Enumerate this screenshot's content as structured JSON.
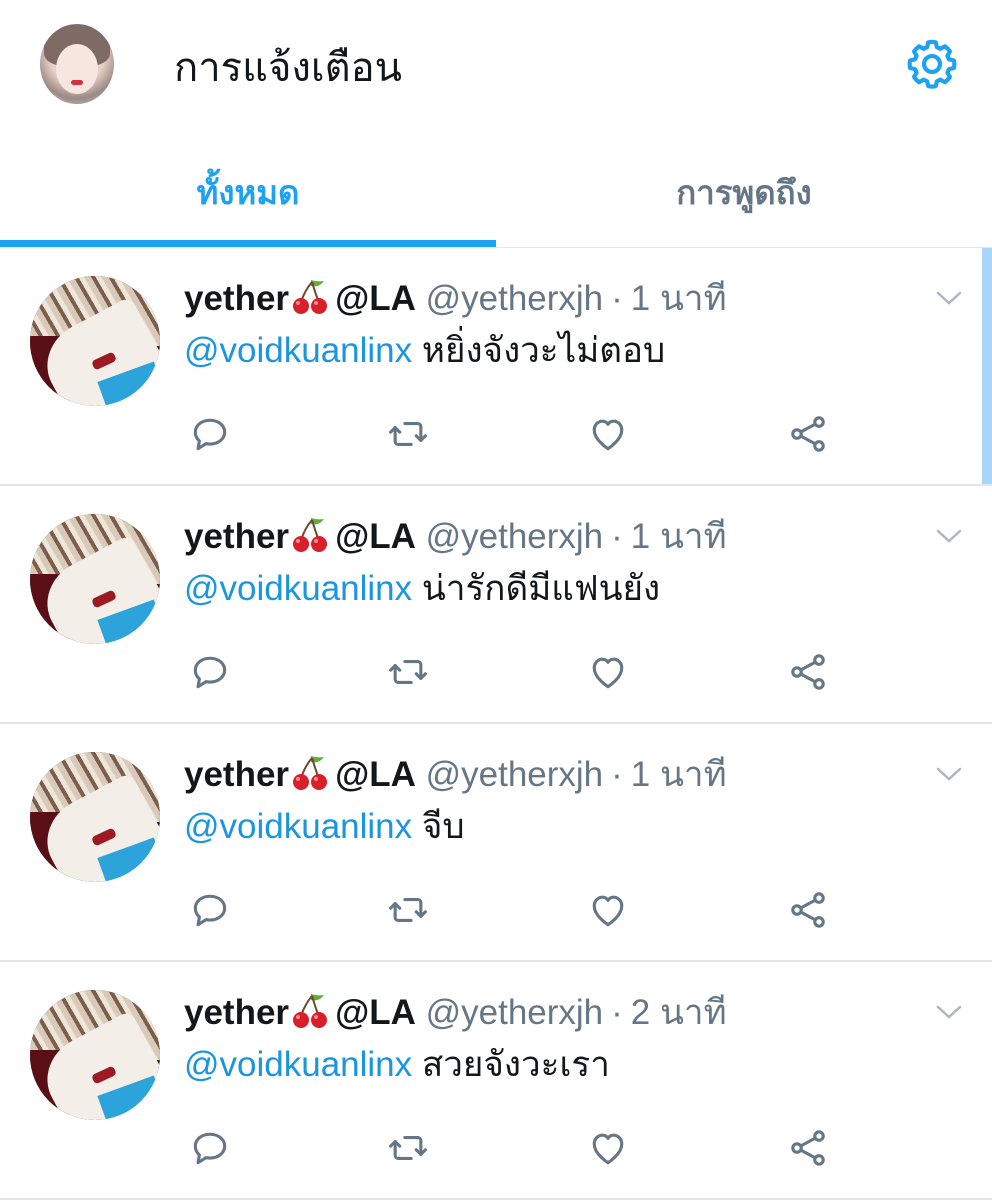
{
  "header": {
    "title": "การแจ้งเตือน",
    "settings_icon": "gear-icon"
  },
  "tabs": [
    {
      "label": "ทั้งหมด",
      "active": true
    },
    {
      "label": "การพูดถึง",
      "active": false
    }
  ],
  "colors": {
    "accent": "#1da1f2",
    "secondary_text": "#657786",
    "primary_text": "#14171a",
    "divider": "#e1e8ed"
  },
  "tweets": [
    {
      "display_name": "yether",
      "name_suffix": "@LA",
      "handle": "@yetherxjh",
      "separator": "·",
      "time": "1 นาที",
      "mention": "@voidkuanlinx",
      "text": "หยิ่งจังวะไม่ตอบ"
    },
    {
      "display_name": "yether",
      "name_suffix": "@LA",
      "handle": "@yetherxjh",
      "separator": "·",
      "time": "1 นาที",
      "mention": "@voidkuanlinx",
      "text": "น่ารักดีมีแฟนยัง"
    },
    {
      "display_name": "yether",
      "name_suffix": "@LA",
      "handle": "@yetherxjh",
      "separator": "·",
      "time": "1 นาที",
      "mention": "@voidkuanlinx",
      "text": "จีบ"
    },
    {
      "display_name": "yether",
      "name_suffix": "@LA",
      "handle": "@yetherxjh",
      "separator": "·",
      "time": "2 นาที",
      "mention": "@voidkuanlinx",
      "text": "สวยจังวะเรา"
    }
  ],
  "action_icons": [
    "reply-icon",
    "retweet-icon",
    "like-icon",
    "share-icon"
  ]
}
